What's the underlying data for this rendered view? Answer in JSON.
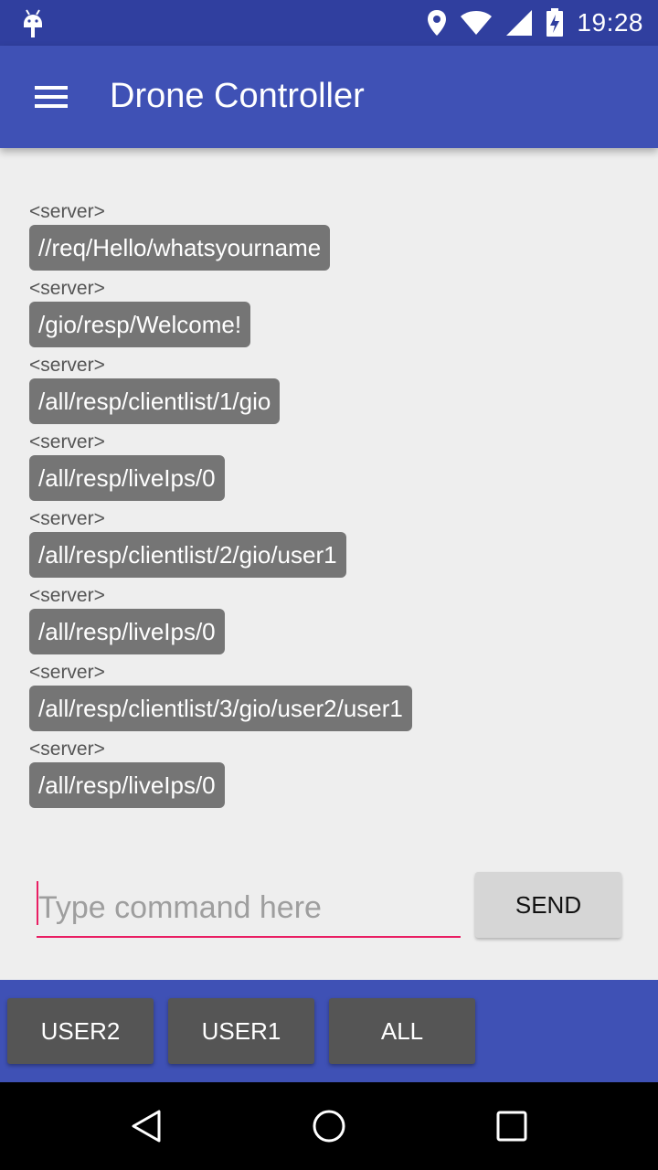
{
  "status_bar": {
    "time": "19:28"
  },
  "app_bar": {
    "title": "Drone Controller"
  },
  "messages": [
    {
      "sender": "<server>",
      "text": "//req/Hello/whatsyourname"
    },
    {
      "sender": "<server>",
      "text": "/gio/resp/Welcome!"
    },
    {
      "sender": "<server>",
      "text": "/all/resp/clientlist/1/gio"
    },
    {
      "sender": "<server>",
      "text": "/all/resp/liveIps/0"
    },
    {
      "sender": "<server>",
      "text": "/all/resp/clientlist/2/gio/user1"
    },
    {
      "sender": "<server>",
      "text": "/all/resp/liveIps/0"
    },
    {
      "sender": "<server>",
      "text": "/all/resp/clientlist/3/gio/user2/user1"
    },
    {
      "sender": "<server>",
      "text": "/all/resp/liveIps/0"
    }
  ],
  "input": {
    "placeholder": "Type command here",
    "value": ""
  },
  "send_button": {
    "label": "SEND"
  },
  "bottom_buttons": [
    "USER2",
    "USER1",
    "ALL"
  ],
  "colors": {
    "primary": "#3f51b5",
    "primary_dark": "#303f9f",
    "accent": "#e91e63",
    "bubble": "#757575"
  }
}
